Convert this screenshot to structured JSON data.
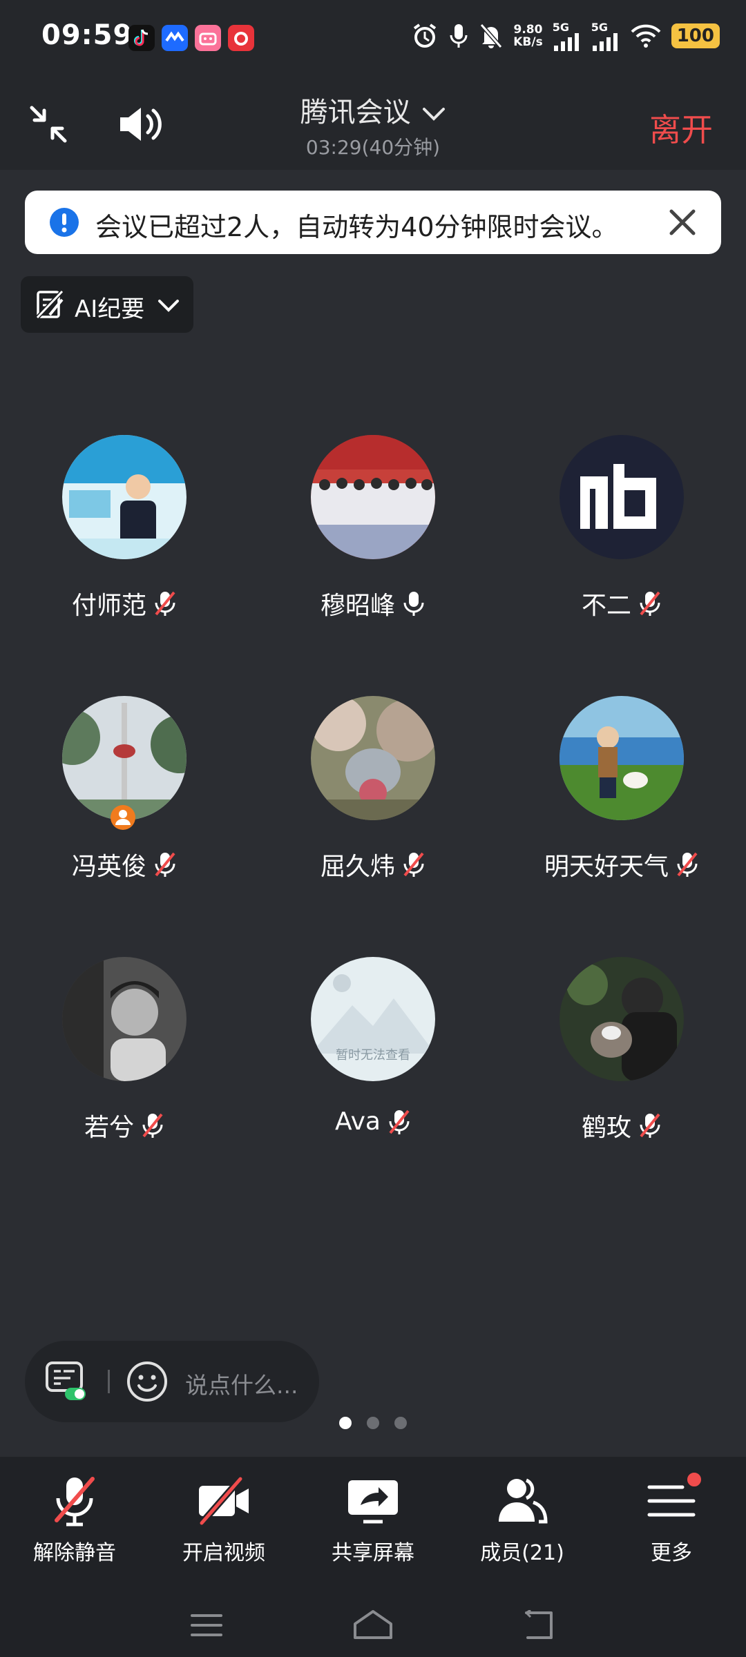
{
  "status_bar": {
    "time": "09:59",
    "net_speed_value": "9.80",
    "net_speed_unit": "KB/s",
    "sim1": "5G",
    "sim2": "5G",
    "battery": "100"
  },
  "header": {
    "title": "腾讯会议",
    "elapsed": "03:29(40分钟)",
    "leave_label": "离开"
  },
  "notice": {
    "text": "会议已超过2人，自动转为40分钟限时会议。"
  },
  "ai_summary": {
    "label": "AI纪要"
  },
  "participants": [
    {
      "name": "付师范",
      "mic": "muted"
    },
    {
      "name": "穆昭峰",
      "mic": "on"
    },
    {
      "name": "不二",
      "mic": "muted"
    },
    {
      "name": "冯英俊",
      "mic": "muted",
      "host": true
    },
    {
      "name": "屈久炜",
      "mic": "muted"
    },
    {
      "name": "明天好天气",
      "mic": "muted"
    },
    {
      "name": "若兮",
      "mic": "muted"
    },
    {
      "name": "Ava",
      "mic": "muted",
      "avatar_caption": "暂时无法查看"
    },
    {
      "name": "鹤玫",
      "mic": "muted"
    }
  ],
  "chat": {
    "placeholder": "说点什么..."
  },
  "pager": {
    "total": 3,
    "active": 1
  },
  "toolbar": {
    "unmute_label": "解除静音",
    "video_label": "开启视频",
    "share_label": "共享屏幕",
    "members_label": "成员(21)",
    "more_label": "更多"
  },
  "colors": {
    "background": "#2b2d32",
    "leave": "#f04c4c",
    "muted_slash": "#f04c4c",
    "notice_icon": "#1a73e8",
    "battery": "#f5c242",
    "host_badge": "#f07b1e"
  }
}
